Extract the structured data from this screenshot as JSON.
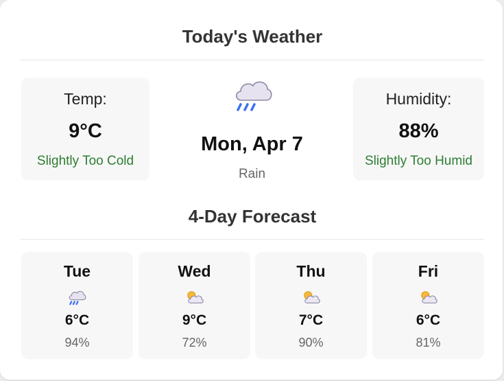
{
  "header": {
    "title": "Today's Weather"
  },
  "today": {
    "temp_label": "Temp:",
    "temp_value": "9°C",
    "temp_status": "Slightly Too Cold",
    "date": "Mon, Apr 7",
    "condition": "Rain",
    "condition_icon": "rain-cloud-icon",
    "humidity_label": "Humidity:",
    "humidity_value": "88%",
    "humidity_status": "Slightly Too Humid",
    "status_color": "#2e7d32"
  },
  "forecast": {
    "title": "4-Day Forecast",
    "days": [
      {
        "day": "Tue",
        "icon": "rain-cloud-icon",
        "temp": "6°C",
        "humidity": "94%"
      },
      {
        "day": "Wed",
        "icon": "partly-cloudy-icon",
        "temp": "9°C",
        "humidity": "72%"
      },
      {
        "day": "Thu",
        "icon": "partly-cloudy-icon",
        "temp": "7°C",
        "humidity": "90%"
      },
      {
        "day": "Fri",
        "icon": "partly-cloudy-icon",
        "temp": "6°C",
        "humidity": "81%"
      }
    ]
  }
}
